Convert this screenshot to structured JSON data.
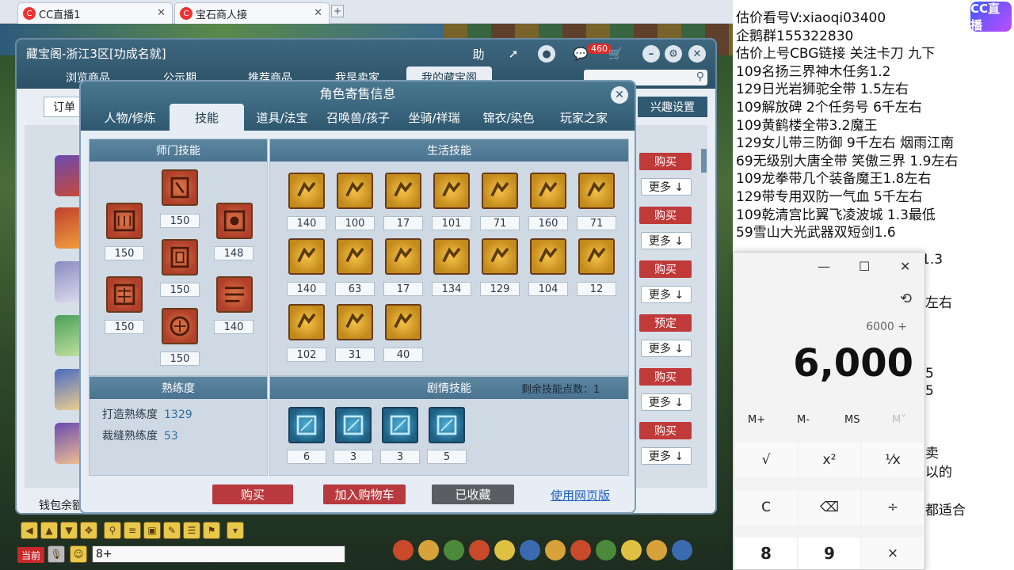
{
  "browser": {
    "tabs": [
      {
        "label": "CC直播1"
      },
      {
        "label": "宝石商人接"
      }
    ],
    "new_tab": "+"
  },
  "cbg": {
    "title": "藏宝阁-浙江3区[功成名就]",
    "header_buttons": {
      "help": "助",
      "badge_count": "460"
    },
    "nav_tabs": [
      "浏览商品",
      "公示期",
      "推荐商品",
      "我是卖家",
      "我的藏宝阁"
    ],
    "order_label": "订单",
    "interest_label": "兴趣设置",
    "buy_label": "购买",
    "reserve_label": "预定",
    "more_label": "更多 ↓",
    "wallet_label": "钱包余额"
  },
  "modal": {
    "title": "角色寄售信息",
    "tabs": [
      "人物/修炼",
      "技能",
      "道具/法宝",
      "召唤兽/孩子",
      "坐骑/祥瑞",
      "锦衣/染色",
      "玩家之家"
    ],
    "active_tab": "技能",
    "sect_skills": {
      "title": "师门技能",
      "levels": [
        "150",
        "150",
        "150",
        "150",
        "150",
        "150",
        "148",
        "140"
      ]
    },
    "life_skills": {
      "title": "生活技能",
      "levels": [
        "140",
        "100",
        "17",
        "101",
        "71",
        "160",
        "71",
        "140",
        "63",
        "17",
        "134",
        "129",
        "104",
        "12",
        "102",
        "31",
        "40"
      ]
    },
    "proficiency": {
      "title": "熟练度",
      "craft_label": "打造熟练度",
      "craft_value": "1329",
      "tailor_label": "裁缝熟练度",
      "tailor_value": "53"
    },
    "story_skills": {
      "title": "剧情技能",
      "remaining": "剩余技能点数：1",
      "levels": [
        "6",
        "3",
        "3",
        "5"
      ]
    },
    "buttons": {
      "buy": "购买",
      "add_cart": "加入购物车",
      "favorited": "已收藏",
      "web_link": "使用网页版"
    }
  },
  "game": {
    "channel": "当前",
    "chat_input": "8+"
  },
  "right_panel": {
    "logo": "CC直播",
    "lines": [
      "估价看号V:xiaoqi03400",
      "企鹅群155322830",
      "估价上号CBG链接 关注卡刀 九下",
      "109名扬三界神木任务1.2",
      "129日光岩狮驼全带  1.5左右",
      "109解放碑 2个任务号 6千左右",
      "109黄鹤楼全带3.2魔王",
      "129女儿带三防御 9千左右 烟雨江南",
      "69无级别大唐全带  笑傲三界 1.9左右",
      "109龙拳带几个装备魔王1.8左右",
      "129带专用双防一气血 5千左右",
      "109乾清宫比翼飞凌波城 1.3最低",
      "59雪山大光武器双短剑1.6"
    ],
    "peek_texts": [
      "1.3",
      "左右",
      "5",
      "5",
      "卖",
      "以的",
      "都适合"
    ]
  },
  "calculator": {
    "expression": "6000 +",
    "display": "6,000",
    "memory": [
      "M+",
      "M-",
      "MS",
      "M˅"
    ],
    "keys_row1": [
      "√",
      "x²",
      "¹⁄x"
    ],
    "keys_row2": [
      "C",
      "⌫",
      "÷"
    ],
    "keys_row3": [
      "8",
      "9",
      "×"
    ]
  }
}
